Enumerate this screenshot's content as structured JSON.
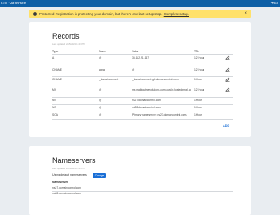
{
  "topbar": {
    "brand": "n.nn · JanetHare",
    "right_icon": "exit-icon",
    "right_label": "Ex"
  },
  "banner": {
    "icon": "info-icon",
    "message": "Protected Registration is protecting your domain, but there's one last setup step.",
    "link": "Complete setup.",
    "close": "×"
  },
  "records": {
    "title": "Records",
    "last_updated": "Last updated 2/15/2023 1:40 PM",
    "columns": [
      "Type",
      "Name",
      "Value",
      "TTL"
    ],
    "rows": [
      {
        "type": "A",
        "name": "@",
        "value": "35.182.91.167",
        "ttl": "1/2 Hour",
        "editable": true
      },
      {
        "type": "CNAME",
        "name": "www",
        "value": "@",
        "ttl": "1/2 Hour",
        "editable": true
      },
      {
        "type": "CNAME",
        "name": "_domainconnect",
        "value": "_domainconnect.gd.domaincontrol.com",
        "ttl": "1 Hour",
        "editable": true
      },
      {
        "type": "MX",
        "name": "@",
        "value": "mx.mailroutinesolutions.com.cust.b.hostedemail.com",
        "ttl": "1/2 Hour",
        "editable": true
      },
      {
        "type": "NS",
        "name": "@",
        "value": "ns27.domaincontrol.com",
        "ttl": "1 Hour",
        "editable": false
      },
      {
        "type": "NS",
        "name": "@",
        "value": "ns28.domaincontrol.com",
        "ttl": "1 Hour",
        "editable": false
      },
      {
        "type": "SOA",
        "name": "@",
        "value": "Primary nameserver: ns27.domaincontrol.com.",
        "ttl": "1 Hour",
        "editable": false
      }
    ],
    "add_label": "ADD",
    "edit_icon": "edit-icon"
  },
  "nameservers": {
    "title": "Nameservers",
    "last_updated": "Last updated 2/15/2023 1:40 PM",
    "using_text": "Using default nameservers",
    "change_label": "Change",
    "header": "Nameserver",
    "items": [
      "ns27.domaincontrol.com",
      "ns28.domaincontrol.com"
    ]
  },
  "colors": {
    "topbar": "#0d5fa6",
    "banner": "#ffe16b",
    "accent": "#1a6fd6",
    "page_bg": "#e9edf1"
  }
}
